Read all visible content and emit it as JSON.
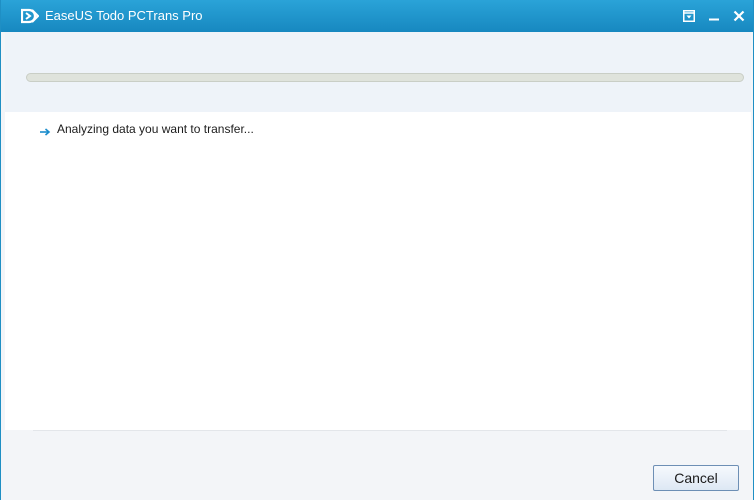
{
  "window": {
    "title": "EaseUS Todo PCTrans Pro",
    "logo_icon": "easeus-logo-icon",
    "controls": {
      "menu_icon": "dropdown-menu-icon",
      "minimize_icon": "minimize-icon",
      "close_icon": "close-icon"
    }
  },
  "progress": {
    "value_percent": 0,
    "track_color": "#dfe3dc",
    "fill_color": "#a6c982"
  },
  "status": {
    "icon": "arrow-right-icon",
    "text": "Analyzing data you want to transfer..."
  },
  "footer": {
    "cancel_label": "Cancel"
  },
  "colors": {
    "titlebar": "#1f96cf",
    "accent": "#1788c0"
  }
}
